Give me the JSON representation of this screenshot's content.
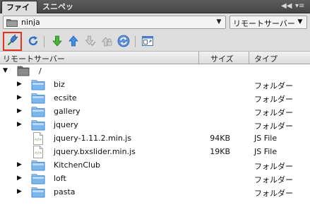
{
  "tabs": {
    "files": "ファイル",
    "snippets": "スニペット"
  },
  "tab_controls": {
    "collapse": "◀◀",
    "menu": "▾≡"
  },
  "site_selector": {
    "value": "ninja"
  },
  "server_selector": {
    "value": "リモートサーバー"
  },
  "columns": {
    "name": "リモートサーバー",
    "size": "サイズ",
    "type": "タイプ"
  },
  "tree": {
    "root": {
      "label": "/"
    },
    "items": [
      {
        "name": "biz",
        "size": "",
        "type": "フォルダー",
        "kind": "folder"
      },
      {
        "name": "ecsite",
        "size": "",
        "type": "フォルダー",
        "kind": "folder"
      },
      {
        "name": "gallery",
        "size": "",
        "type": "フォルダー",
        "kind": "folder"
      },
      {
        "name": "jquery",
        "size": "",
        "type": "フォルダー",
        "kind": "folder"
      },
      {
        "name": "jquery-1.11.2.min.js",
        "size": "94KB",
        "type": "JS File",
        "kind": "file"
      },
      {
        "name": "jquery.bxslider.min.js",
        "size": "19KB",
        "type": "JS File",
        "kind": "file"
      },
      {
        "name": "KitchenClub",
        "size": "",
        "type": "フォルダー",
        "kind": "folder"
      },
      {
        "name": "loft",
        "size": "",
        "type": "フォルダー",
        "kind": "folder"
      },
      {
        "name": "pasta",
        "size": "",
        "type": "フォルダー",
        "kind": "folder"
      }
    ]
  },
  "icons": {
    "connect": "connect-plug-icon",
    "refresh": "refresh-icon",
    "get": "get-files-down-arrow-icon",
    "put": "put-files-up-arrow-icon",
    "checkout": "check-out-icon",
    "checkin": "check-in-icon",
    "sync": "synchronize-icon",
    "expand": "expand-panel-icon"
  },
  "colors": {
    "tab_bar": "#4f4f4f",
    "panel": "#dedede",
    "highlight": "#e8301c",
    "folder": "#5ea7e6",
    "get_arrow": "#3aa12a",
    "put_arrow": "#2f7fd6"
  }
}
